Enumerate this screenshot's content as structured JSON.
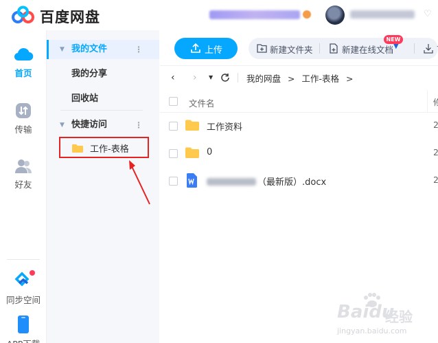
{
  "app": {
    "name": "百度网盘"
  },
  "colors": {
    "accent": "#06a7ff",
    "highlight_box": "#e62222",
    "folder": "#ffc94d",
    "new_badge": "#ff3b5c"
  },
  "leftnav": {
    "items": [
      {
        "label": "首页",
        "icon": "cloud-icon",
        "active": true
      },
      {
        "label": "传输",
        "icon": "transfer-icon",
        "active": false
      },
      {
        "label": "好友",
        "icon": "friends-icon",
        "active": false
      }
    ],
    "sync_space": {
      "label": "同步空间",
      "icon": "sync-icon"
    },
    "app_download": {
      "label": "APP下载",
      "icon": "phone-icon"
    }
  },
  "sidebar": {
    "my_files": "我的文件",
    "my_share": "我的分享",
    "recycle_bin": "回收站",
    "quick_access": "快捷访问",
    "quick_items": [
      {
        "label": "工作-表格",
        "icon": "folder-icon"
      }
    ]
  },
  "toolbar": {
    "upload": "上传",
    "new_folder": "新建文件夹",
    "new_online_doc": "新建在线文档",
    "new_badge": "NEW",
    "download_partial": "下"
  },
  "breadcrumb": {
    "path": [
      "我的网盘",
      "工作-表格"
    ],
    "separator": ">"
  },
  "file_list": {
    "header_name": "文件名",
    "header_right_partial": "修",
    "rows": [
      {
        "name": "工作资料",
        "type": "folder",
        "date_partial": "2"
      },
      {
        "name": "0",
        "type": "folder",
        "date_partial": "2"
      },
      {
        "name": "（最新版）.docx",
        "type": "word",
        "date_partial": "2"
      }
    ]
  },
  "watermark": {
    "brand": "Baidu",
    "cn": "经验",
    "url": "jingyan.baidu.com"
  }
}
